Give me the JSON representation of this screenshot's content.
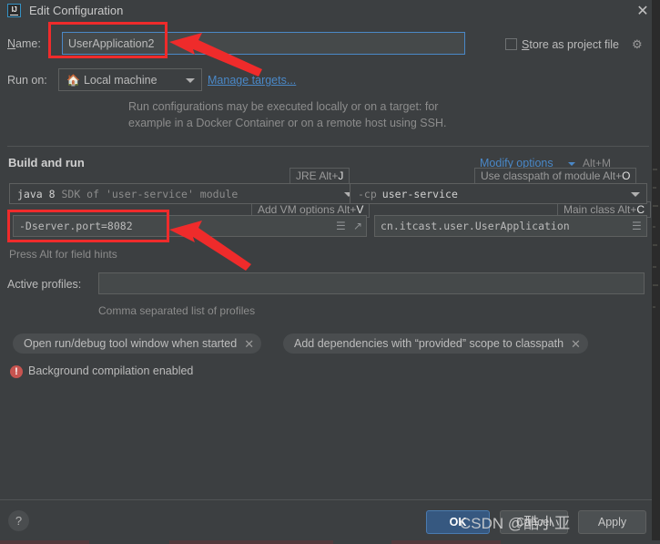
{
  "window": {
    "title": "Edit Configuration",
    "app_icon": "intellij-idea-icon",
    "close_icon": "close-icon"
  },
  "name_row": {
    "label": "Name:",
    "value": "UserApplication2",
    "store_as_project_file_label": "Store as project file",
    "store_as_project_file_checked": false,
    "gear_icon": "gear-icon"
  },
  "run_on": {
    "label": "Run on:",
    "target_value": "Local machine",
    "target_icon": "home-icon",
    "manage_targets_link": "Manage targets...",
    "description_line1": "Run configurations may be executed locally or on a target: for",
    "description_line2": "example in a Docker Container or on a remote host using SSH."
  },
  "build_and_run": {
    "section_title": "Build and run",
    "modify_options_link": "Modify options",
    "modify_options_shortcut": "Alt+M",
    "hint_jre": "JRE Alt+J",
    "hint_jre_key": "J",
    "hint_classpath": "Use classpath of module Alt+O",
    "hint_classpath_key": "O",
    "hint_vm_options": "Add VM options Alt+V",
    "hint_vm_options_key": "V",
    "hint_main_class": "Main class Alt+C",
    "hint_main_class_key": "C",
    "jre_value_bold": "java 8",
    "jre_value_rest": "SDK of 'user-service' module",
    "classpath_prefix": "-cp",
    "classpath_value": "user-service",
    "vm_options_value": "-Dserver.port=8082",
    "vm_options_expand_icon": "expand-icon",
    "vm_options_list_icon": "list-icon",
    "main_class_value": "cn.itcast.user.UserApplication",
    "main_class_browse_icon": "browse-icon",
    "field_hints_text": "Press Alt for field hints"
  },
  "active_profiles": {
    "label": "Active profiles:",
    "value": "",
    "helper_text": "Comma separated list of profiles"
  },
  "chips": [
    {
      "label": "Open run/debug tool window when started",
      "close_icon": "close-icon"
    },
    {
      "label": "Add dependencies with  “provided”  scope to classpath",
      "close_icon": "close-icon"
    }
  ],
  "status": {
    "icon": "warning-icon",
    "text": "Background compilation enabled"
  },
  "footer": {
    "help_label": "?",
    "ok_label": "OK",
    "cancel_label": "Cancel",
    "apply_label": "Apply"
  },
  "watermark": {
    "text": "CSDN @酷小亚"
  },
  "annotations": {
    "name_highlight": "red-box-around-name-field",
    "vm_options_highlight": "red-box-around-vm-options-field"
  },
  "colors": {
    "background": "#3c3f41",
    "field_background": "#45494a",
    "accent_blue": "#4a88c7",
    "primary_button": "#365880",
    "annotation_red": "#ef2b2b",
    "warning_red": "#c75450"
  }
}
